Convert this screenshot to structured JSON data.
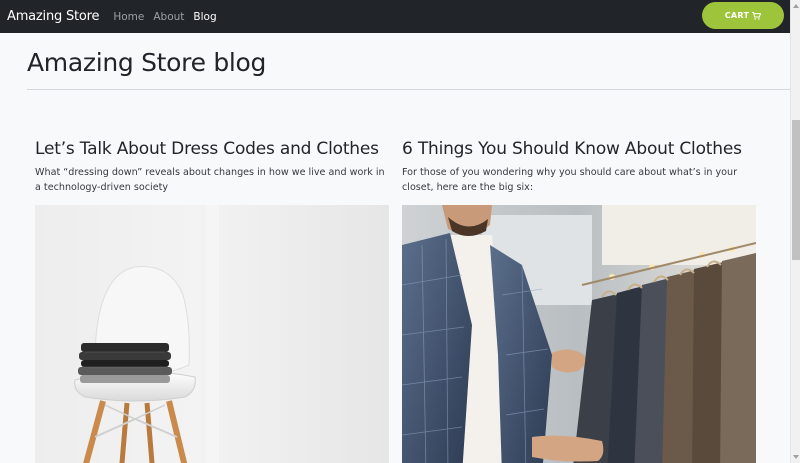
{
  "navbar": {
    "brand": "Amazing Store",
    "links": [
      {
        "label": "Home",
        "active": false
      },
      {
        "label": "About",
        "active": false
      },
      {
        "label": "Blog",
        "active": true
      }
    ],
    "cart_label": "CART",
    "cart_color": "#9dc43a",
    "background": "#212529"
  },
  "page": {
    "title": "Amazing Store blog"
  },
  "posts": [
    {
      "title": "Let’s Talk About Dress Codes and Clothes",
      "excerpt": "What “dressing down” reveals about changes in how we live and work in a technology-driven society",
      "image_icon": "white-chair-with-folded-clothes-image"
    },
    {
      "title": "6 Things You Should Know About Clothes",
      "excerpt": "For those of you wondering why you should care about what’s in your closet, here are the big six:",
      "image_icon": "man-browsing-suit-rack-image"
    }
  ]
}
